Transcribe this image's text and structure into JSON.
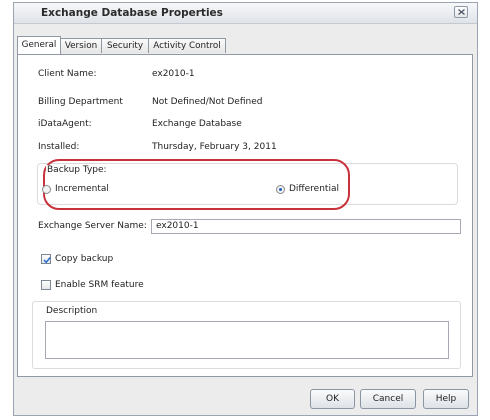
{
  "window": {
    "title": "Exchange Database Properties"
  },
  "tabs": [
    {
      "label": "General",
      "active": true
    },
    {
      "label": "Version",
      "active": false
    },
    {
      "label": "Security",
      "active": false
    },
    {
      "label": "Activity Control",
      "active": false
    }
  ],
  "fields": {
    "client_name": {
      "label": "Client Name:",
      "value": "ex2010-1"
    },
    "billing": {
      "label": "Billing Department",
      "value": "Not Defined/Not Defined"
    },
    "idataagent": {
      "label": "iDataAgent:",
      "value": "Exchange Database"
    },
    "installed": {
      "label": "Installed:",
      "value": "Thursday, February 3, 2011"
    }
  },
  "backup_type": {
    "legend": "Backup Type:",
    "options": [
      {
        "label": "Incremental",
        "selected": false
      },
      {
        "label": "Differential",
        "selected": true
      }
    ]
  },
  "exchange_server": {
    "label": "Exchange Server Name:",
    "value": "ex2010-1"
  },
  "checkboxes": {
    "copy_backup": {
      "label": "Copy backup",
      "checked": true
    },
    "enable_srm": {
      "label": "Enable SRM feature",
      "checked": false
    }
  },
  "description": {
    "legend": "Description",
    "value": ""
  },
  "buttons": {
    "ok": "OK",
    "cancel": "Cancel",
    "help": "Help"
  },
  "colors": {
    "highlight_ring": "#c8323c",
    "radio_selected": "#1f63c7",
    "check_mark": "#2a6bd1"
  },
  "icons": {
    "close": "close-icon",
    "check": "check-icon"
  }
}
